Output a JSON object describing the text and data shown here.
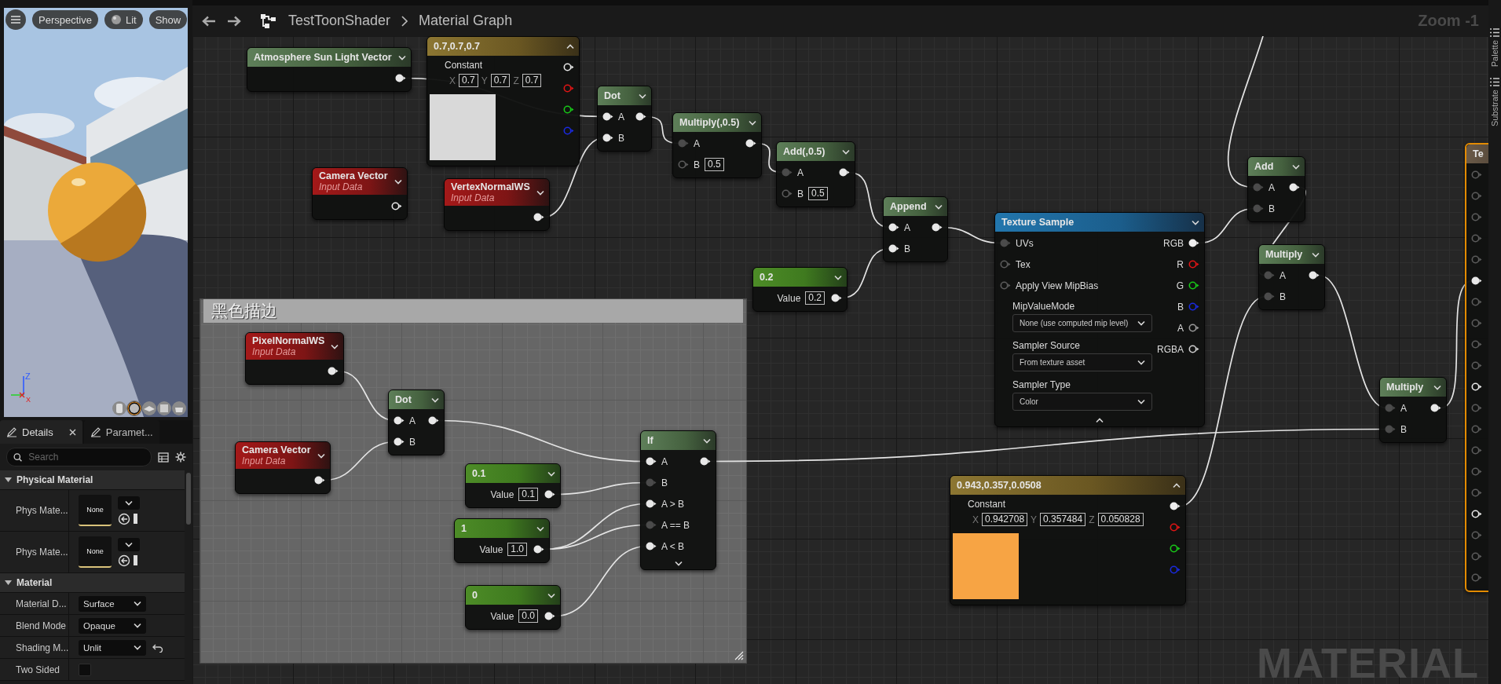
{
  "viewport": {
    "buttons": [
      {
        "label": "Perspective",
        "kind": "plain"
      },
      {
        "label": "Lit",
        "kind": "sphere"
      },
      {
        "label": "Show",
        "kind": "plain"
      }
    ],
    "axis_labels": [
      "Z",
      "X"
    ],
    "preview_shapes": [
      {
        "selected": false
      },
      {
        "selected": true
      },
      {
        "selected": false
      },
      {
        "selected": false
      },
      {
        "selected": false
      }
    ]
  },
  "details": {
    "tabs": [
      {
        "label": "Details",
        "selected": true,
        "closable": true
      },
      {
        "label": "Paramet...",
        "selected": false,
        "closable": false
      }
    ],
    "search": {
      "placeholder": "Search"
    },
    "sections": [
      {
        "title": "Physical Material",
        "expanded": true,
        "rows": [
          {
            "kind": "asset",
            "label": "Phys Mate...",
            "value": "None"
          },
          {
            "kind": "asset",
            "label": "Phys Mate...",
            "value": "None"
          }
        ]
      },
      {
        "title": "Material",
        "expanded": true,
        "rows": [
          {
            "kind": "dropdown",
            "label": "Material D...",
            "value": "Surface",
            "modified": false
          },
          {
            "kind": "dropdown",
            "label": "Blend Mode",
            "value": "Opaque",
            "modified": false
          },
          {
            "kind": "dropdown",
            "label": "Shading M...",
            "value": "Unlit",
            "modified": true
          },
          {
            "kind": "checkbox",
            "label": "Two Sided",
            "checked": false
          }
        ]
      }
    ]
  },
  "graph": {
    "breadcrumbs": [
      "TestToonShader",
      "Material Graph"
    ],
    "zoom_label": "Zoom -1",
    "nodes": [
      {
        "kind": "function",
        "title": "Atmosphere Sun Light Vector",
        "outputs": [
          {
            "filled": true,
            "dim": false
          }
        ]
      },
      {
        "kind": "vector",
        "title": "0.7,0.7,0.7",
        "label": "Constant",
        "fields": [
          {
            "axis": "X",
            "value": "0.7"
          },
          {
            "axis": "Y",
            "value": "0.7"
          },
          {
            "axis": "Z",
            "value": "0.7"
          }
        ],
        "color": "#d9d9d9",
        "outputs": [
          {
            "filled": false,
            "dim": false,
            "color": "#e6e6e6"
          },
          {
            "filled": false,
            "dim": false,
            "color": "#e01515"
          },
          {
            "filled": false,
            "dim": false,
            "color": "#18c818"
          },
          {
            "filled": false,
            "dim": false,
            "color": "#1a2ae0"
          }
        ]
      },
      {
        "kind": "function",
        "title": "Dot",
        "inputs": [
          {
            "label": "A",
            "filled": true,
            "dim": false
          },
          {
            "label": "B",
            "filled": true,
            "dim": false
          }
        ],
        "outputs": [
          {
            "filled": true,
            "dim": false
          }
        ]
      },
      {
        "kind": "function",
        "title": "Multiply(,0.5)",
        "inputs": [
          {
            "label": "A",
            "filled": true,
            "dim": true
          },
          {
            "label": "B",
            "filled": false,
            "dim": true,
            "value": "0.5"
          }
        ],
        "outputs": [
          {
            "filled": true,
            "dim": false
          }
        ]
      },
      {
        "kind": "input",
        "title": "Camera Vector",
        "subtitle": "Input Data",
        "outputs": [
          {
            "filled": false,
            "dim": false
          }
        ]
      },
      {
        "kind": "input",
        "title": "VertexNormalWS",
        "subtitle": "Input Data",
        "outputs": [
          {
            "filled": true,
            "dim": false
          }
        ]
      },
      {
        "kind": "function",
        "title": "Add(,0.5)",
        "inputs": [
          {
            "label": "A",
            "filled": true,
            "dim": true
          },
          {
            "label": "B",
            "filled": false,
            "dim": true,
            "value": "0.5"
          }
        ],
        "outputs": [
          {
            "filled": true,
            "dim": false
          }
        ]
      },
      {
        "kind": "function",
        "title": "Append",
        "inputs": [
          {
            "label": "A",
            "filled": true,
            "dim": false
          },
          {
            "label": "B",
            "filled": true,
            "dim": false
          }
        ],
        "outputs": [
          {
            "filled": true,
            "dim": false
          }
        ]
      },
      {
        "kind": "scalar",
        "title": "0.2",
        "inputs": [
          {
            "label": "Value",
            "value": "0.2"
          }
        ],
        "outputs": [
          {
            "filled": true,
            "dim": false
          }
        ]
      },
      {
        "kind": "texture",
        "title": "Texture Sample",
        "inputs": [
          {
            "label": "UVs",
            "filled": true,
            "dim": true
          },
          {
            "label": "Tex",
            "filled": false,
            "dim": true
          },
          {
            "label": "Apply View MipBias",
            "filled": false,
            "dim": true
          }
        ],
        "outputs": [
          {
            "label": "RGB",
            "filled": true,
            "dim": false,
            "color": "#eeeeee"
          },
          {
            "label": "R",
            "filled": false,
            "dim": false,
            "color": "#e01515"
          },
          {
            "label": "G",
            "filled": false,
            "dim": false,
            "color": "#18c818"
          },
          {
            "label": "B",
            "filled": false,
            "dim": false,
            "color": "#1a2ae0"
          },
          {
            "label": "A",
            "filled": false,
            "dim": false,
            "color": "#9a9a9a"
          },
          {
            "label": "RGBA",
            "filled": false,
            "dim": false,
            "color": "#cfcfcf"
          }
        ],
        "settings": [
          {
            "label": "MipValueMode",
            "value": "None (use computed mip level)"
          },
          {
            "label": "Sampler Source",
            "value": "From texture asset"
          },
          {
            "label": "Sampler Type",
            "value": "Color"
          }
        ],
        "advanced_expanded": true
      },
      {
        "kind": "function",
        "title": "Add",
        "inputs": [
          {
            "label": "A",
            "filled": true,
            "dim": true
          },
          {
            "label": "B",
            "filled": true,
            "dim": true
          }
        ],
        "outputs": [
          {
            "filled": true,
            "dim": false
          }
        ]
      },
      {
        "kind": "function",
        "title": "Multiply",
        "inputs": [
          {
            "label": "A",
            "filled": true,
            "dim": true
          },
          {
            "label": "B",
            "filled": true,
            "dim": true
          }
        ],
        "outputs": [
          {
            "filled": true,
            "dim": false
          }
        ]
      },
      {
        "kind": "function",
        "title": "Multiply",
        "inputs": [
          {
            "label": "A",
            "filled": true,
            "dim": true
          },
          {
            "label": "B",
            "filled": true,
            "dim": true
          }
        ],
        "outputs": [
          {
            "filled": true,
            "dim": false
          }
        ]
      },
      {
        "kind": "result",
        "title": "Te",
        "inputs": [
          {
            "filled": false,
            "dim": true
          },
          {
            "filled": false,
            "dim": true
          },
          {
            "filled": false,
            "dim": true
          },
          {
            "filled": false,
            "dim": true
          },
          {
            "filled": false,
            "dim": true
          },
          {
            "filled": true,
            "dim": false
          },
          {
            "filled": false,
            "dim": true
          },
          {
            "filled": false,
            "dim": true
          },
          {
            "filled": false,
            "dim": true
          },
          {
            "filled": false,
            "dim": true
          },
          {
            "filled": false,
            "dim": false
          },
          {
            "filled": false,
            "dim": true
          },
          {
            "filled": false,
            "dim": true
          },
          {
            "filled": false,
            "dim": true
          },
          {
            "filled": false,
            "dim": true
          },
          {
            "filled": false,
            "dim": true
          },
          {
            "filled": false,
            "dim": false
          },
          {
            "filled": false,
            "dim": true
          },
          {
            "filled": false,
            "dim": true
          },
          {
            "filled": false,
            "dim": true
          }
        ]
      },
      {
        "kind": "vector",
        "title": "0.943,0.357,0.0508",
        "label": "Constant",
        "fields": [
          {
            "axis": "X",
            "value": "0.942708"
          },
          {
            "axis": "Y",
            "value": "0.357484"
          },
          {
            "axis": "Z",
            "value": "0.050828"
          }
        ],
        "color": "#f7a444",
        "outputs": [
          {
            "filled": true,
            "dim": false,
            "color": "#eeeeee"
          },
          {
            "filled": false,
            "dim": false,
            "color": "#e01515"
          },
          {
            "filled": false,
            "dim": false,
            "color": "#18c818"
          },
          {
            "filled": false,
            "dim": false,
            "color": "#1a2ae0"
          }
        ]
      }
    ],
    "comment": {
      "title": "黑色描边",
      "nodes": [
        {
          "kind": "input",
          "title": "PixelNormalWS",
          "subtitle": "Input Data",
          "outputs": [
            {
              "filled": true,
              "dim": false
            }
          ]
        },
        {
          "kind": "input",
          "title": "Camera Vector",
          "subtitle": "Input Data",
          "outputs": [
            {
              "filled": true,
              "dim": false
            }
          ]
        },
        {
          "kind": "function",
          "title": "Dot",
          "inputs": [
            {
              "label": "A",
              "filled": true,
              "dim": false
            },
            {
              "label": "B",
              "filled": true,
              "dim": false
            }
          ],
          "outputs": [
            {
              "filled": true,
              "dim": false
            }
          ]
        },
        {
          "kind": "scalar",
          "title": "0.1",
          "inputs": [
            {
              "label": "Value",
              "value": "0.1"
            }
          ],
          "outputs": [
            {
              "filled": true,
              "dim": false
            }
          ]
        },
        {
          "kind": "scalar",
          "title": "1",
          "inputs": [
            {
              "label": "Value",
              "value": "1.0"
            }
          ],
          "outputs": [
            {
              "filled": true,
              "dim": false
            }
          ]
        },
        {
          "kind": "scalar",
          "title": "0",
          "inputs": [
            {
              "label": "Value",
              "value": "0.0"
            }
          ],
          "outputs": [
            {
              "filled": true,
              "dim": false
            }
          ]
        },
        {
          "kind": "function",
          "title": "If",
          "inputs": [
            {
              "label": "A",
              "filled": true,
              "dim": false
            },
            {
              "label": "B",
              "filled": true,
              "dim": true
            },
            {
              "label": "A > B",
              "filled": true,
              "dim": false
            },
            {
              "label": "A == B",
              "filled": true,
              "dim": true
            },
            {
              "label": "A < B",
              "filled": true,
              "dim": false
            }
          ],
          "outputs": [
            {
              "filled": true,
              "dim": false
            }
          ],
          "advanced_expanded": false
        }
      ]
    },
    "watermark": "MATERIAL"
  },
  "side_tabs": [
    "Palette",
    "Substrate"
  ]
}
